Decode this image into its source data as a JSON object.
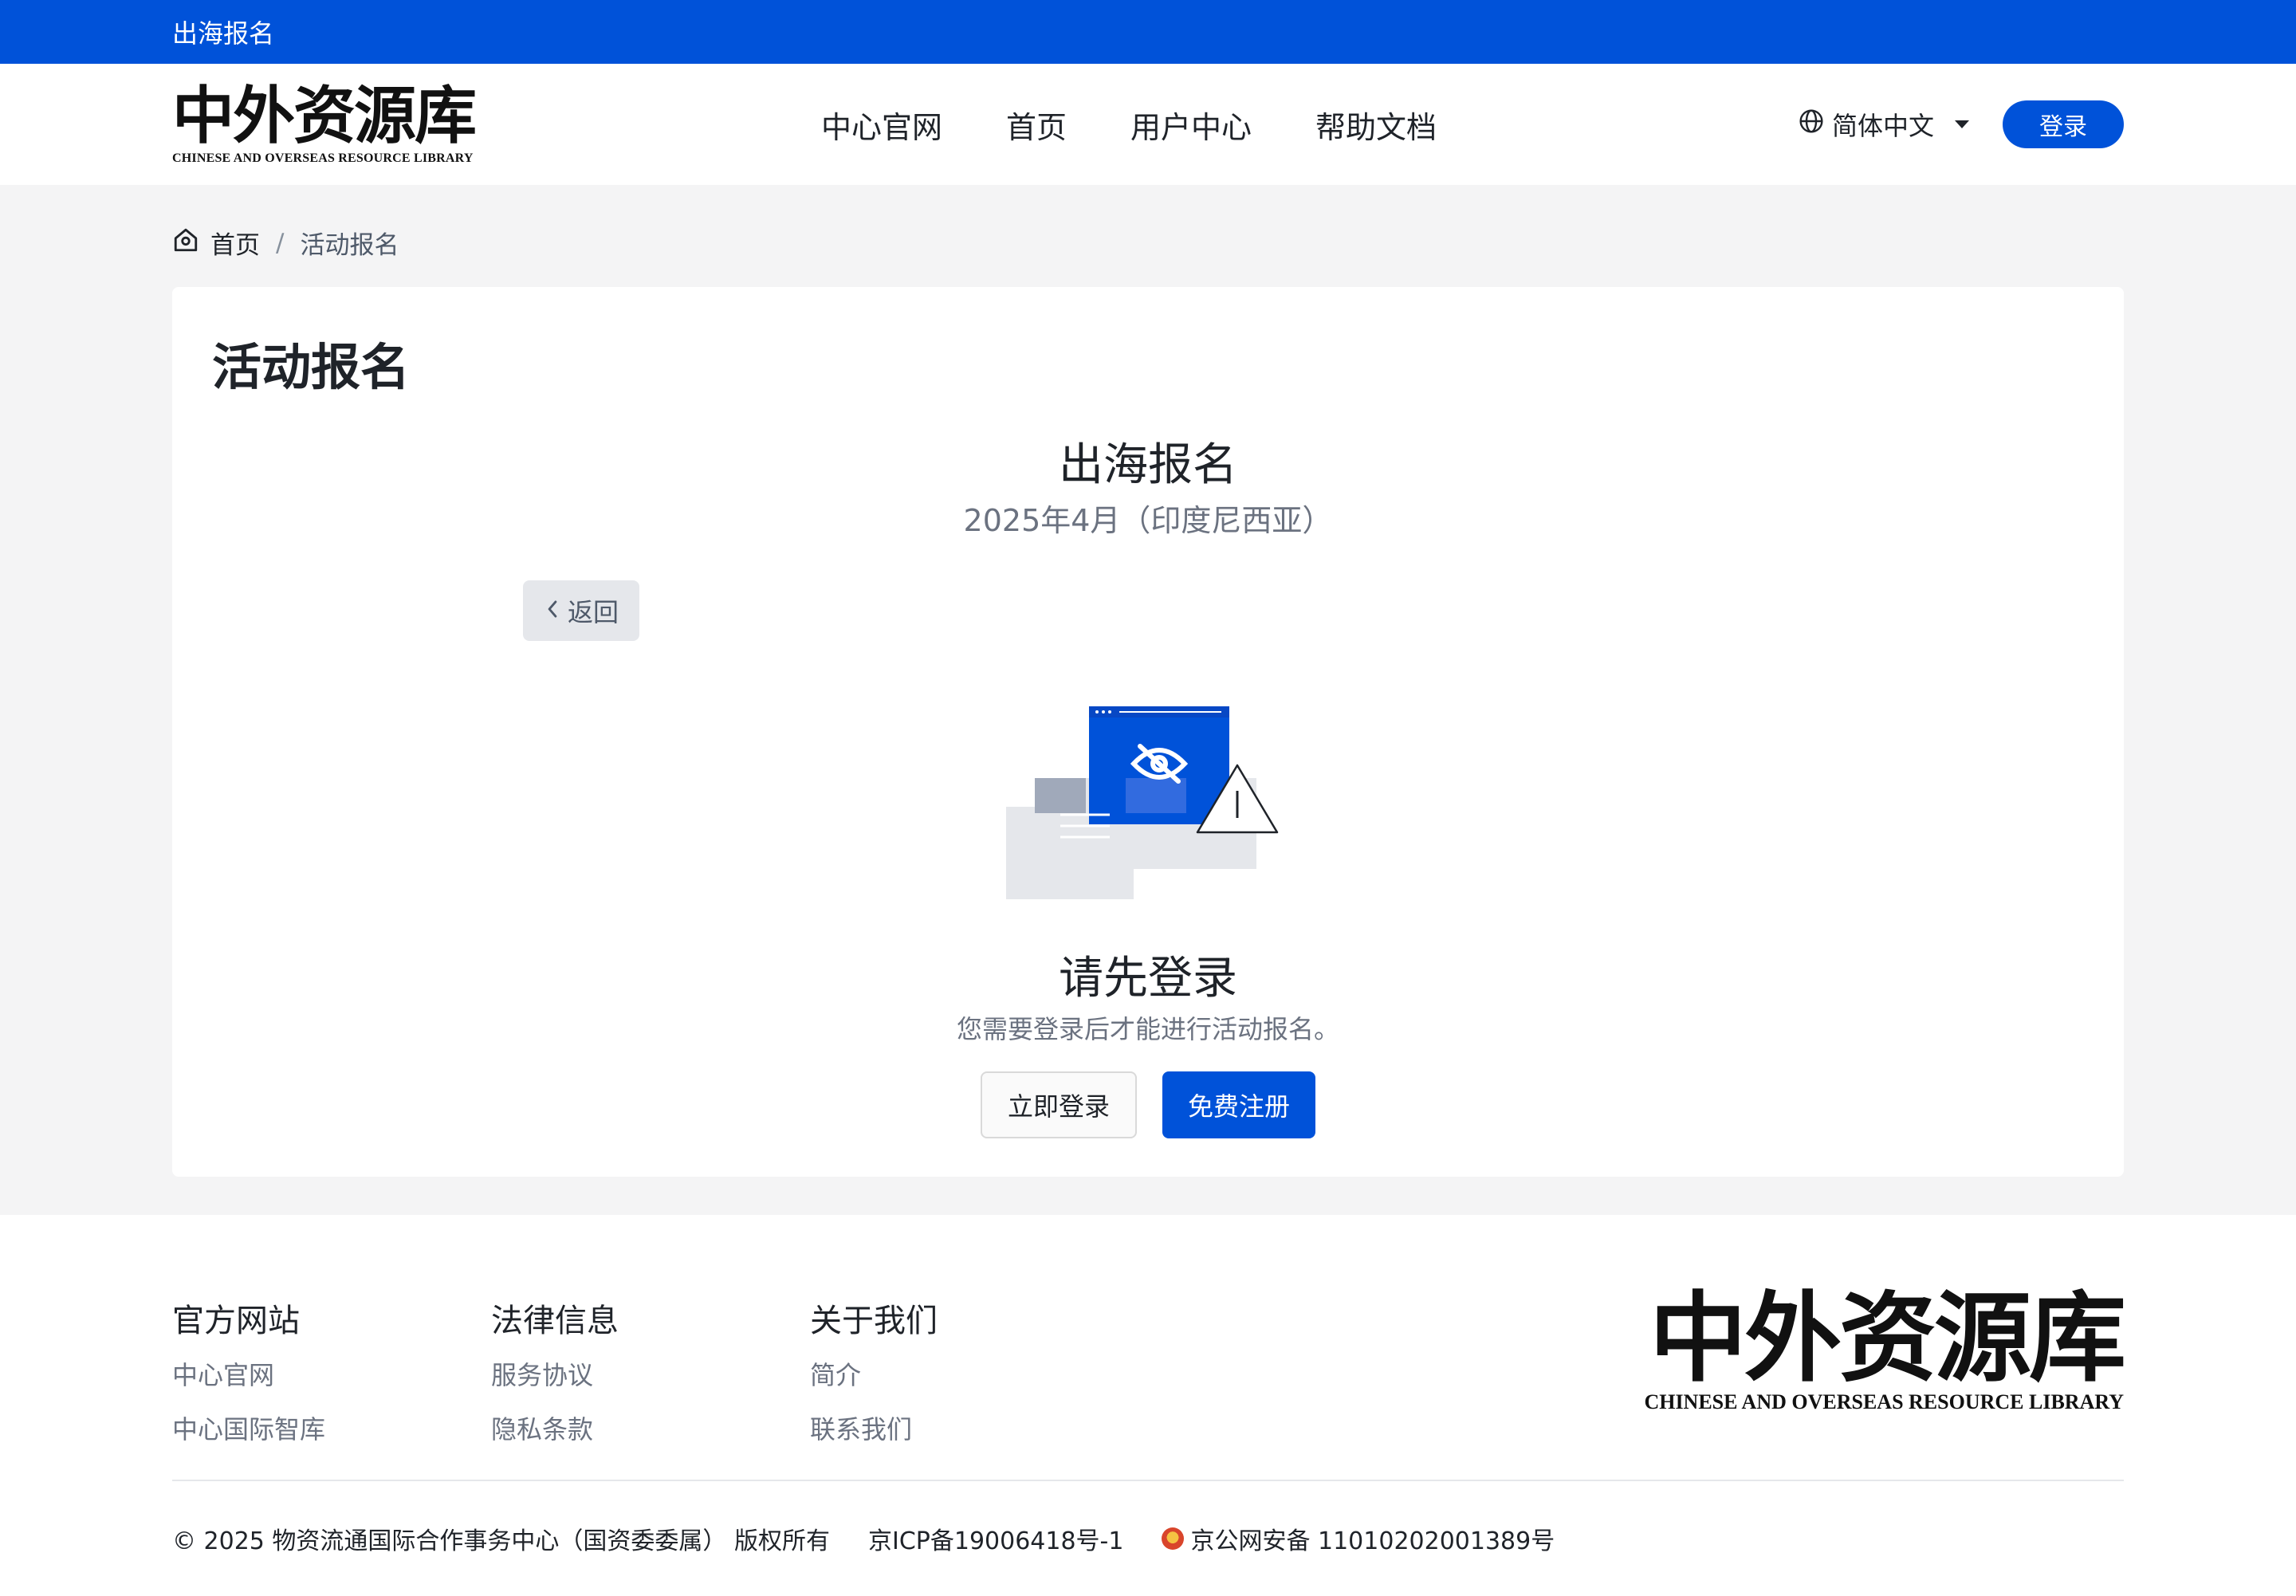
{
  "topbar": {
    "title": "出海报名"
  },
  "brand": {
    "name_cn": "中外资源库",
    "name_en": "CHINESE AND OVERSEAS RESOURCE LIBRARY"
  },
  "nav": {
    "items": [
      {
        "label": "中心官网"
      },
      {
        "label": "首页"
      },
      {
        "label": "用户中心"
      },
      {
        "label": "帮助文档"
      }
    ]
  },
  "language": {
    "selected": "简体中文"
  },
  "header": {
    "login_label": "登录"
  },
  "breadcrumb": {
    "home": "首页",
    "separator": "/",
    "current": "活动报名"
  },
  "card": {
    "title": "活动报名",
    "event_title": "出海报名",
    "event_subtitle": "2025年4月（印度尼西亚）",
    "back_label": "返回",
    "empty": {
      "title": "请先登录",
      "description": "您需要登录后才能进行活动报名。",
      "login_now": "立即登录",
      "register_free": "免费注册"
    }
  },
  "footer": {
    "columns": [
      {
        "title": "官方网站",
        "links": [
          "中心官网",
          "中心国际智库"
        ]
      },
      {
        "title": "法律信息",
        "links": [
          "服务协议",
          "隐私条款"
        ]
      },
      {
        "title": "关于我们",
        "links": [
          "简介",
          "联系我们"
        ]
      }
    ],
    "copyright": "© 2025 物资流通国际合作事务中心（国资委委属） 版权所有",
    "icp": "京ICP备19006418号-1",
    "police_record": "京公网安备 11010202001389号"
  },
  "colors": {
    "primary": "#0052d9",
    "page_bg": "#f4f4f5",
    "text_muted": "#6b7280"
  }
}
